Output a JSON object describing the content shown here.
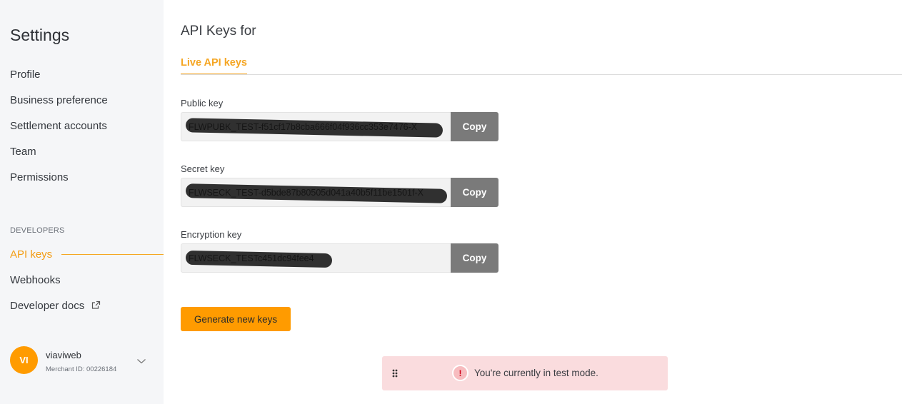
{
  "sidebar": {
    "title": "Settings",
    "items": [
      {
        "label": "Profile"
      },
      {
        "label": "Business preference"
      },
      {
        "label": "Settlement accounts"
      },
      {
        "label": "Team"
      },
      {
        "label": "Permissions"
      }
    ],
    "developers_section": "DEVELOPERS",
    "dev_items": [
      {
        "label": "API keys",
        "active": true
      },
      {
        "label": "Webhooks"
      },
      {
        "label": "Developer docs",
        "icon": "external-link-icon"
      }
    ],
    "user": {
      "initials": "VI",
      "name": "viaviweb",
      "merchant_id": "Merchant ID: 00226184"
    }
  },
  "main": {
    "title": "API Keys for",
    "tab": "Live API keys",
    "fields": [
      {
        "label": "Public key",
        "value": "FLWPUBK_TEST-f51cf17b8cba666f04f936cc353e7476-X",
        "button": "Copy"
      },
      {
        "label": "Secret key",
        "value": "FLWSECK_TEST-d5bde87b80505d041a40b5f11be1501f-X",
        "button": "Copy"
      },
      {
        "label": "Encryption key",
        "value": "FLWSECK_TESTc451dc94fee4",
        "button": "Copy"
      }
    ],
    "generate_button": "Generate new keys"
  },
  "toast": {
    "message": "You're currently in test mode.",
    "icon": "warning-icon"
  },
  "colors": {
    "accent": "#f5a623",
    "button_primary": "#ff9b00",
    "copy_button": "#7a7a7a",
    "toast_bg": "#fadcde"
  }
}
